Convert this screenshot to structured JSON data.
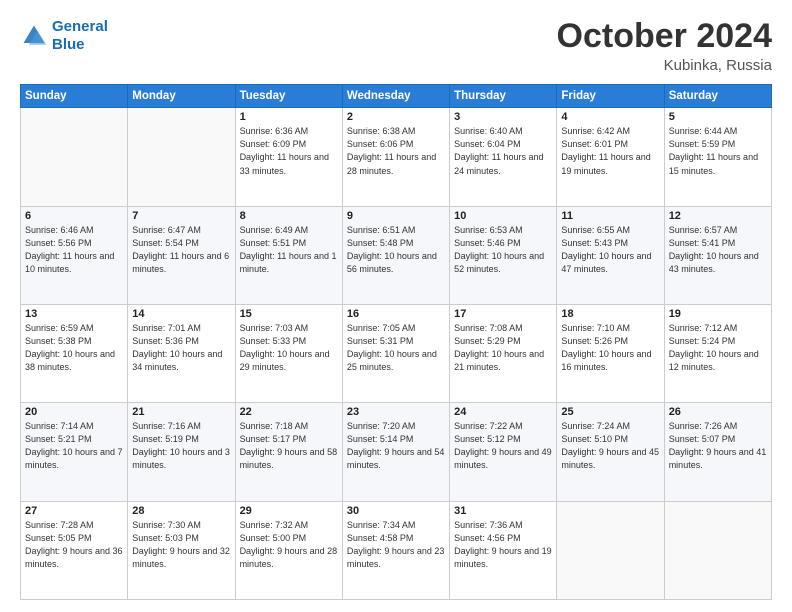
{
  "header": {
    "logo_line1": "General",
    "logo_line2": "Blue",
    "month": "October 2024",
    "location": "Kubinka, Russia"
  },
  "weekdays": [
    "Sunday",
    "Monday",
    "Tuesday",
    "Wednesday",
    "Thursday",
    "Friday",
    "Saturday"
  ],
  "weeks": [
    [
      {
        "day": "",
        "sunrise": "",
        "sunset": "",
        "daylight": ""
      },
      {
        "day": "",
        "sunrise": "",
        "sunset": "",
        "daylight": ""
      },
      {
        "day": "1",
        "sunrise": "Sunrise: 6:36 AM",
        "sunset": "Sunset: 6:09 PM",
        "daylight": "Daylight: 11 hours and 33 minutes."
      },
      {
        "day": "2",
        "sunrise": "Sunrise: 6:38 AM",
        "sunset": "Sunset: 6:06 PM",
        "daylight": "Daylight: 11 hours and 28 minutes."
      },
      {
        "day": "3",
        "sunrise": "Sunrise: 6:40 AM",
        "sunset": "Sunset: 6:04 PM",
        "daylight": "Daylight: 11 hours and 24 minutes."
      },
      {
        "day": "4",
        "sunrise": "Sunrise: 6:42 AM",
        "sunset": "Sunset: 6:01 PM",
        "daylight": "Daylight: 11 hours and 19 minutes."
      },
      {
        "day": "5",
        "sunrise": "Sunrise: 6:44 AM",
        "sunset": "Sunset: 5:59 PM",
        "daylight": "Daylight: 11 hours and 15 minutes."
      }
    ],
    [
      {
        "day": "6",
        "sunrise": "Sunrise: 6:46 AM",
        "sunset": "Sunset: 5:56 PM",
        "daylight": "Daylight: 11 hours and 10 minutes."
      },
      {
        "day": "7",
        "sunrise": "Sunrise: 6:47 AM",
        "sunset": "Sunset: 5:54 PM",
        "daylight": "Daylight: 11 hours and 6 minutes."
      },
      {
        "day": "8",
        "sunrise": "Sunrise: 6:49 AM",
        "sunset": "Sunset: 5:51 PM",
        "daylight": "Daylight: 11 hours and 1 minute."
      },
      {
        "day": "9",
        "sunrise": "Sunrise: 6:51 AM",
        "sunset": "Sunset: 5:48 PM",
        "daylight": "Daylight: 10 hours and 56 minutes."
      },
      {
        "day": "10",
        "sunrise": "Sunrise: 6:53 AM",
        "sunset": "Sunset: 5:46 PM",
        "daylight": "Daylight: 10 hours and 52 minutes."
      },
      {
        "day": "11",
        "sunrise": "Sunrise: 6:55 AM",
        "sunset": "Sunset: 5:43 PM",
        "daylight": "Daylight: 10 hours and 47 minutes."
      },
      {
        "day": "12",
        "sunrise": "Sunrise: 6:57 AM",
        "sunset": "Sunset: 5:41 PM",
        "daylight": "Daylight: 10 hours and 43 minutes."
      }
    ],
    [
      {
        "day": "13",
        "sunrise": "Sunrise: 6:59 AM",
        "sunset": "Sunset: 5:38 PM",
        "daylight": "Daylight: 10 hours and 38 minutes."
      },
      {
        "day": "14",
        "sunrise": "Sunrise: 7:01 AM",
        "sunset": "Sunset: 5:36 PM",
        "daylight": "Daylight: 10 hours and 34 minutes."
      },
      {
        "day": "15",
        "sunrise": "Sunrise: 7:03 AM",
        "sunset": "Sunset: 5:33 PM",
        "daylight": "Daylight: 10 hours and 29 minutes."
      },
      {
        "day": "16",
        "sunrise": "Sunrise: 7:05 AM",
        "sunset": "Sunset: 5:31 PM",
        "daylight": "Daylight: 10 hours and 25 minutes."
      },
      {
        "day": "17",
        "sunrise": "Sunrise: 7:08 AM",
        "sunset": "Sunset: 5:29 PM",
        "daylight": "Daylight: 10 hours and 21 minutes."
      },
      {
        "day": "18",
        "sunrise": "Sunrise: 7:10 AM",
        "sunset": "Sunset: 5:26 PM",
        "daylight": "Daylight: 10 hours and 16 minutes."
      },
      {
        "day": "19",
        "sunrise": "Sunrise: 7:12 AM",
        "sunset": "Sunset: 5:24 PM",
        "daylight": "Daylight: 10 hours and 12 minutes."
      }
    ],
    [
      {
        "day": "20",
        "sunrise": "Sunrise: 7:14 AM",
        "sunset": "Sunset: 5:21 PM",
        "daylight": "Daylight: 10 hours and 7 minutes."
      },
      {
        "day": "21",
        "sunrise": "Sunrise: 7:16 AM",
        "sunset": "Sunset: 5:19 PM",
        "daylight": "Daylight: 10 hours and 3 minutes."
      },
      {
        "day": "22",
        "sunrise": "Sunrise: 7:18 AM",
        "sunset": "Sunset: 5:17 PM",
        "daylight": "Daylight: 9 hours and 58 minutes."
      },
      {
        "day": "23",
        "sunrise": "Sunrise: 7:20 AM",
        "sunset": "Sunset: 5:14 PM",
        "daylight": "Daylight: 9 hours and 54 minutes."
      },
      {
        "day": "24",
        "sunrise": "Sunrise: 7:22 AM",
        "sunset": "Sunset: 5:12 PM",
        "daylight": "Daylight: 9 hours and 49 minutes."
      },
      {
        "day": "25",
        "sunrise": "Sunrise: 7:24 AM",
        "sunset": "Sunset: 5:10 PM",
        "daylight": "Daylight: 9 hours and 45 minutes."
      },
      {
        "day": "26",
        "sunrise": "Sunrise: 7:26 AM",
        "sunset": "Sunset: 5:07 PM",
        "daylight": "Daylight: 9 hours and 41 minutes."
      }
    ],
    [
      {
        "day": "27",
        "sunrise": "Sunrise: 7:28 AM",
        "sunset": "Sunset: 5:05 PM",
        "daylight": "Daylight: 9 hours and 36 minutes."
      },
      {
        "day": "28",
        "sunrise": "Sunrise: 7:30 AM",
        "sunset": "Sunset: 5:03 PM",
        "daylight": "Daylight: 9 hours and 32 minutes."
      },
      {
        "day": "29",
        "sunrise": "Sunrise: 7:32 AM",
        "sunset": "Sunset: 5:00 PM",
        "daylight": "Daylight: 9 hours and 28 minutes."
      },
      {
        "day": "30",
        "sunrise": "Sunrise: 7:34 AM",
        "sunset": "Sunset: 4:58 PM",
        "daylight": "Daylight: 9 hours and 23 minutes."
      },
      {
        "day": "31",
        "sunrise": "Sunrise: 7:36 AM",
        "sunset": "Sunset: 4:56 PM",
        "daylight": "Daylight: 9 hours and 19 minutes."
      },
      {
        "day": "",
        "sunrise": "",
        "sunset": "",
        "daylight": ""
      },
      {
        "day": "",
        "sunrise": "",
        "sunset": "",
        "daylight": ""
      }
    ]
  ]
}
